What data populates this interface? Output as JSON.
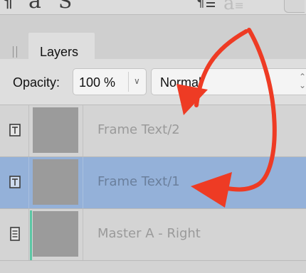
{
  "toolbar": {
    "glyph_pilcrow": "¶",
    "glyph_a": "a",
    "glyph_s": "S",
    "glyph_a_faded": "a"
  },
  "panel": {
    "tab_label": "Layers"
  },
  "controls": {
    "opacity_label": "Opacity:",
    "opacity_value": "100 %",
    "blend_mode": "Normal"
  },
  "layers": [
    {
      "name": "Frame Text/2",
      "icon": "text-frame-icon",
      "selected": false
    },
    {
      "name": "Frame Text/1",
      "icon": "text-frame-icon",
      "selected": true
    },
    {
      "name": "Master A - Right",
      "icon": "master-page-icon",
      "selected": false
    }
  ],
  "colors": {
    "selection": "#94b1d9",
    "annotation_arrow": "#ee3b24",
    "master_marker": "#5cc7a4"
  }
}
